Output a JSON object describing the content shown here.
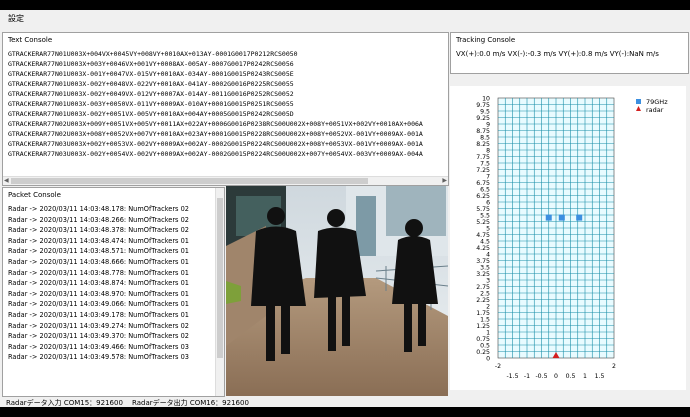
{
  "menu": {
    "settings_label": "設定"
  },
  "text_console": {
    "title": "Text Console",
    "lines": [
      "GTRACKERAR77N01U003X+004VX+0045VY+008VY+0010AX+013AY-0001G0017P0212RCS0050",
      "GTRACKERAR77N01U003X+003Y+0046VX+001VY+0008AX-005AY-0007G0017P0242RCS0056",
      "GTRACKERAR77N01U003X-001Y+0047VX-015VY+0010AX-034AY-0001G0015P0243RCS005E",
      "GTRACKERAR77N01U003X-002Y+0048VX-022VY+0010AX-041AY-0002G0016P0225RCS0055",
      "GTRACKERAR77N01U003X-002Y+0049VX-012VY+0007AX-014AY-0011G0016P0252RCS0052",
      "GTRACKERAR77N01U003X-003Y+0050VX-011VY+0009AX-010AY+0001G0015P0251RCS0055",
      "GTRACKERAR77N01U003X-002Y+0051VX-005VY+0010AX+004AY+0005G0015P0242RCS005D",
      "GTRACKERAR77N02U003X+009Y+0051VX+005VY+0011AX+022AY+0006G0016P0238RCS00U002X+008Y+0051VX+002VY+0010AX+006A",
      "GTRACKERAR77N02U003X+008Y+0052VX+007VY+0010AX+023AY+0001G0015P0228RCS00U002X+008Y+0052VX-001VY+0009AX-001A",
      "GTRACKERAR77N03U003X+002Y+0053VX-002VY+0009AX+002AY-0002G0015P0224RCS00U002X+008Y+0053VX-001VY+0009AX-001A",
      "GTRACKERAR77N03U003X-002Y+0054VX-002VY+0009AX+002AY-0002G0015P0224RCS00U002X+007Y+0054VX-003VY+0009AX-004A"
    ]
  },
  "tracking_console": {
    "title": "Tracking Console",
    "readout": "VX(+):0.0 m/s    VX(-):-0.3 m/s    VY(+):0.8 m/s    VY(-):NaN m/s"
  },
  "packet_console": {
    "title": "Packet Console",
    "lines": [
      "Radar -> 2020/03/11 14:03:48.178: NumOfTrackers 02",
      "Radar -> 2020/03/11 14:03:48.266: NumOfTrackers 02",
      "Radar -> 2020/03/11 14:03:48.378: NumOfTrackers 02",
      "Radar -> 2020/03/11 14:03:48.474: NumOfTrackers 01",
      "Radar -> 2020/03/11 14:03:48.571: NumOfTrackers 01",
      "Radar -> 2020/03/11 14:03:48.666: NumOfTrackers 01",
      "Radar -> 2020/03/11 14:03:48.778: NumOfTrackers 01",
      "Radar -> 2020/03/11 14:03:48.874: NumOfTrackers 01",
      "Radar -> 2020/03/11 14:03:48.970: NumOfTrackers 01",
      "Radar -> 2020/03/11 14:03:49.066: NumOfTrackers 01",
      "Radar -> 2020/03/11 14:03:49.178: NumOfTrackers 01",
      "Radar -> 2020/03/11 14:03:49.274: NumOfTrackers 02",
      "Radar -> 2020/03/11 14:03:49.370: NumOfTrackers 02",
      "Radar -> 2020/03/11 14:03:49.466: NumOfTrackers 03",
      "Radar -> 2020/03/11 14:03:49.578: NumOfTrackers 03"
    ]
  },
  "status": {
    "input": "Radarデータ入力 COM15：921600",
    "output": "Radarデータ出力 COM16：921600"
  },
  "colors": {
    "grid_fill": "#e8fbff",
    "grid_line": "#1a8fa8",
    "tracker": "#3b8fe0",
    "radar": "#d42020"
  },
  "chart_data": {
    "type": "scatter",
    "xlim": [
      -2,
      2
    ],
    "ylim": [
      0,
      10
    ],
    "x_ticks": [
      "-1.5",
      "-1",
      "-0.5",
      "0",
      "0.5",
      "1",
      "1.5"
    ],
    "x_tick_values": [
      -1.5,
      -1,
      -0.5,
      0,
      0.5,
      1,
      1.5
    ],
    "x_edge_ticks": [
      "-2",
      "2"
    ],
    "y_ticks": [
      "0",
      "0.25",
      "0.5",
      "0.75",
      "1",
      "1.25",
      "1.5",
      "1.75",
      "2",
      "2.25",
      "2.5",
      "2.75",
      "3",
      "3.25",
      "3.5",
      "3.75",
      "4",
      "4.25",
      "4.5",
      "4.75",
      "5",
      "5.25",
      "5.5",
      "5.75",
      "6",
      "6.25",
      "6.5",
      "6.75",
      "7",
      "7.25",
      "7.5",
      "7.75",
      "8",
      "8.25",
      "8.5",
      "8.75",
      "9",
      "9.25",
      "9.5",
      "9.75",
      "10"
    ],
    "grid": true,
    "legend_position": "top-right",
    "series": [
      {
        "name": "79GHz",
        "marker": "square",
        "x": [
          -0.25,
          0.2,
          0.8
        ],
        "y": [
          5.4,
          5.4,
          5.4
        ]
      },
      {
        "name": "radar",
        "marker": "triangle",
        "x": [
          0
        ],
        "y": [
          0
        ]
      }
    ]
  }
}
